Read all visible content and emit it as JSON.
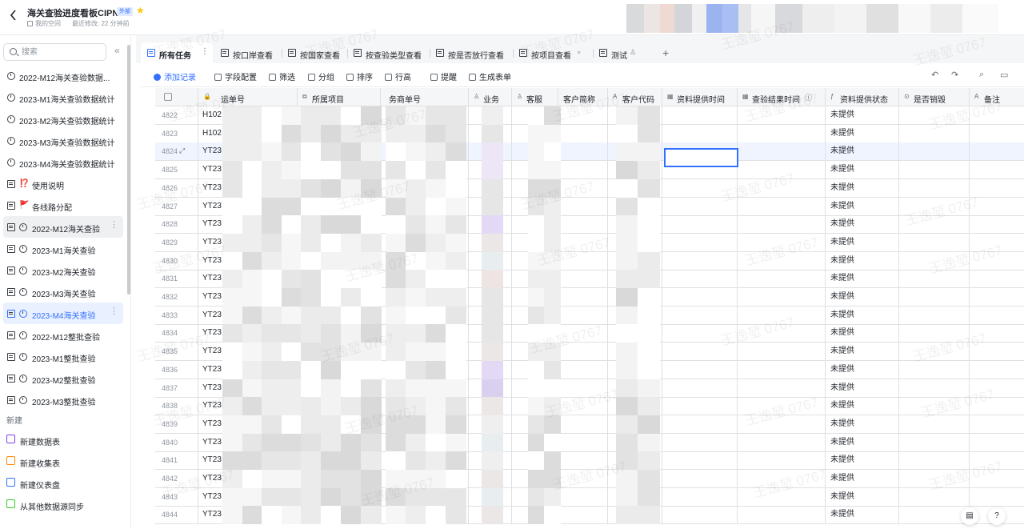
{
  "header": {
    "title": "海关查验进度看板CIPN",
    "badge": "外部",
    "space": "我的空间",
    "modified": "最近修改: 22 分钟前"
  },
  "sidebar": {
    "search_placeholder": "搜索",
    "items": [
      {
        "label": "2022-M12海关查验数据...",
        "icon": "clock-icon"
      },
      {
        "label": "2023-M1海关查验数据统计",
        "icon": "clock-icon"
      },
      {
        "label": "2023-M2海关查验数据统计",
        "icon": "clock-icon"
      },
      {
        "label": "2023-M3海关查验数据统计",
        "icon": "clock-icon"
      },
      {
        "label": "2023-M4海关查验数据统计",
        "icon": "clock-icon"
      },
      {
        "label": "使用说明",
        "icon": "table-icon",
        "emoji": "⁉️"
      },
      {
        "label": "各线路分配",
        "icon": "table-icon",
        "emoji": "🚩"
      },
      {
        "label": "2022-M12海关查验",
        "icon": "table-icon"
      },
      {
        "label": "2023-M1海关查验",
        "icon": "table-icon"
      },
      {
        "label": "2023-M2海关查验",
        "icon": "table-icon"
      },
      {
        "label": "2023-M3海关查验",
        "icon": "table-icon"
      },
      {
        "label": "2023-M4海关查验",
        "icon": "table-icon"
      },
      {
        "label": "2022-M12整批查验",
        "icon": "table-icon"
      },
      {
        "label": "2023-M1整批查验",
        "icon": "table-icon"
      },
      {
        "label": "2023-M2整批查验",
        "icon": "table-icon"
      },
      {
        "label": "2023-M3整批查验",
        "icon": "table-icon"
      }
    ],
    "new_header": "新建",
    "new_items": [
      {
        "label": "新建数据表",
        "color": "#7f3bf5"
      },
      {
        "label": "新建收集表",
        "color": "#ff8800"
      },
      {
        "label": "新建仪表盘",
        "color": "#3370ff"
      },
      {
        "label": "从其他数据源同步",
        "color": "#34c724"
      }
    ]
  },
  "tabs": [
    {
      "label": "所有任务"
    },
    {
      "label": "按口岸查看"
    },
    {
      "label": "按国家查看"
    },
    {
      "label": "按查验类型查看"
    },
    {
      "label": "按是否放行查看"
    },
    {
      "label": "按项目查看"
    },
    {
      "label": "测试"
    }
  ],
  "toolbar": {
    "add": "添加记录",
    "fields": "字段配置",
    "filter": "筛选",
    "group": "分组",
    "sort": "排序",
    "row_height": "行高",
    "remind": "提醒",
    "form": "生成表单"
  },
  "columns": {
    "c1": "运单号",
    "c2": "所属项目",
    "c3": "务商单号",
    "c4": "业务",
    "c5": "客服",
    "c6": "客户简称",
    "c7": "客户代码",
    "c8": "资料提供时间",
    "c9": "查验结果时间",
    "c10": "资料提供状态",
    "c11": "是否销毁",
    "c12": "备注"
  },
  "rows": [
    {
      "n": "4822",
      "id": "H102",
      "status": "未提供"
    },
    {
      "n": "4823",
      "id": "H102",
      "status": "未提供"
    },
    {
      "n": "4824",
      "id": "YT23",
      "status": "未提供"
    },
    {
      "n": "4825",
      "id": "YT23",
      "status": "未提供"
    },
    {
      "n": "4826",
      "id": "YT23",
      "status": "未提供"
    },
    {
      "n": "4827",
      "id": "YT23",
      "status": "未提供"
    },
    {
      "n": "4828",
      "id": "YT23",
      "status": "未提供"
    },
    {
      "n": "4829",
      "id": "YT23",
      "status": "未提供"
    },
    {
      "n": "4830",
      "id": "YT23",
      "status": "未提供"
    },
    {
      "n": "4831",
      "id": "YT23",
      "status": "未提供"
    },
    {
      "n": "4832",
      "id": "YT23",
      "status": "未提供"
    },
    {
      "n": "4833",
      "id": "YT23",
      "status": "未提供"
    },
    {
      "n": "4834",
      "id": "YT23",
      "status": "未提供"
    },
    {
      "n": "4835",
      "id": "YT23",
      "status": "未提供"
    },
    {
      "n": "4836",
      "id": "YT23",
      "status": "未提供"
    },
    {
      "n": "4837",
      "id": "YT23",
      "status": "未提供"
    },
    {
      "n": "4838",
      "id": "YT23",
      "status": "未提供"
    },
    {
      "n": "4839",
      "id": "YT23",
      "status": "未提供"
    },
    {
      "n": "4840",
      "id": "YT23",
      "status": "未提供"
    },
    {
      "n": "4841",
      "id": "YT23",
      "status": "未提供"
    },
    {
      "n": "4842",
      "id": "YT23",
      "status": "未提供"
    },
    {
      "n": "4843",
      "id": "YT23",
      "status": "未提供"
    },
    {
      "n": "4844",
      "id": "YT23",
      "status": "未提供"
    }
  ],
  "watermark": "王逸堃 0767",
  "colors": {
    "accent": "#3370ff",
    "star": "#ffc60a"
  }
}
